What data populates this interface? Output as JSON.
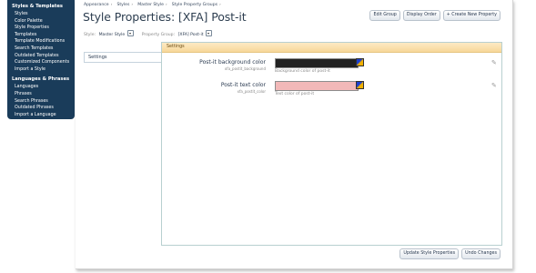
{
  "sidebar": {
    "sections": [
      {
        "heading": "Styles & Templates",
        "items": [
          "Styles",
          "Color Palette",
          "Style Properties",
          "Templates",
          "Template Modifications",
          "Search Templates",
          "Outdated Templates",
          "Customized Components",
          "Import a Style"
        ]
      },
      {
        "heading": "Languages & Phrases",
        "items": [
          "Languages",
          "Phrases",
          "Search Phrases",
          "Outdated Phrases",
          "Import a Language"
        ]
      }
    ]
  },
  "breadcrumb": [
    "Appearance",
    "Styles",
    "Master Style",
    "Style Property Groups"
  ],
  "breadcrumb_sep": "›",
  "page": {
    "title": "Style Properties: [XFA] Post-it"
  },
  "buttons": {
    "edit_group": "Edit Group",
    "display_order": "Display Order",
    "create_property": "+ Create New Property",
    "update": "Update Style Properties",
    "undo": "Undo Changes"
  },
  "filters": {
    "style_label": "Style:",
    "style_value": "Master Style",
    "group_label": "Property Group:",
    "group_value": "[XFA] Post-it"
  },
  "tabs": {
    "settings": "Settings"
  },
  "panel": {
    "header": "Settings"
  },
  "properties": [
    {
      "label": "Post-it background color",
      "var": "xfa_postit_background",
      "value": "",
      "description": "Background color of post-it",
      "color": "#222222",
      "edit_icon": "pencil-icon"
    },
    {
      "label": "Post-it text color",
      "var": "xfa_postit_color",
      "value": "",
      "description": "Text color of post-it",
      "color": "#f2b8b8",
      "edit_icon": "pencil-icon"
    }
  ],
  "colors": {
    "sidebar_bg": "#1a3c5a",
    "panel_header": "#f7d79a",
    "title_text": "#2d3e50"
  }
}
